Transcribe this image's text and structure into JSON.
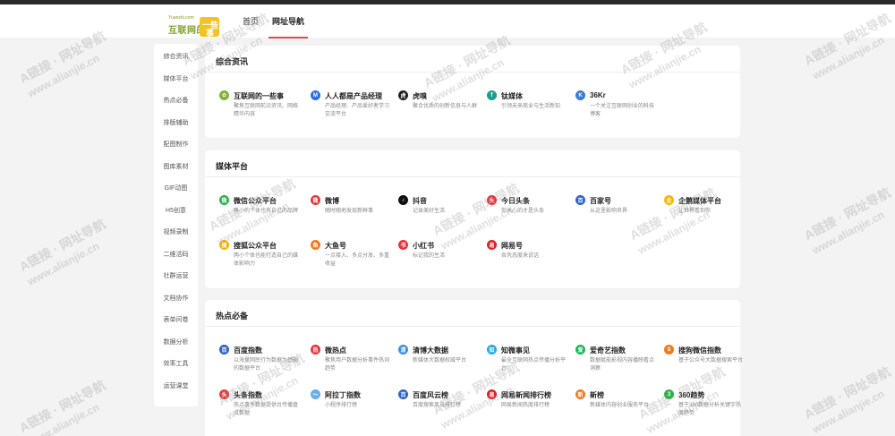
{
  "header": {
    "logo_small": "Yuanshi.com",
    "logo_main": "互联网的",
    "logo_badge_1": "一些",
    "logo_badge_2": "事",
    "nav": [
      {
        "label": "首页"
      },
      {
        "label": "网址导航"
      }
    ]
  },
  "sidebar": {
    "items": [
      {
        "label": "综合资讯"
      },
      {
        "label": "媒体平台"
      },
      {
        "label": "热点必备"
      },
      {
        "label": "排版辅助"
      },
      {
        "label": "配图制作"
      },
      {
        "label": "图库素材"
      },
      {
        "label": "GIF动图"
      },
      {
        "label": "H5创意"
      },
      {
        "label": "视频录制"
      },
      {
        "label": "二维活码"
      },
      {
        "label": "社群运营"
      },
      {
        "label": "文档协作"
      },
      {
        "label": "表单问卷"
      },
      {
        "label": "数据分析"
      },
      {
        "label": "效率工具"
      },
      {
        "label": "运营课堂"
      }
    ]
  },
  "sections": [
    {
      "title": "综合资讯",
      "sites": [
        {
          "name": "互联网的一些事",
          "desc": "聚焦互联网前沿资讯、网络精华内容",
          "icon": "leaf-icon",
          "color": "#86b234",
          "glyph": "✿"
        },
        {
          "name": "人人都是产品经理",
          "desc": "产品经理、产品爱好者学习交流平台",
          "icon": "m-logo-icon",
          "color": "#2d6fe0",
          "glyph": "M"
        },
        {
          "name": "虎嗅",
          "desc": "聚合优质的创新信息与人群",
          "icon": "huxiu-icon",
          "color": "#1f1f1f",
          "glyph": "虎"
        },
        {
          "name": "钛媒体",
          "desc": "引领未来商业与生活新知",
          "icon": "tmt-icon",
          "color": "#19a08a",
          "glyph": "T"
        },
        {
          "name": "36Kr",
          "desc": "一个关注互联网创业的科技博客",
          "icon": "36kr-icon",
          "color": "#3a7bd5",
          "glyph": "K"
        }
      ]
    },
    {
      "title": "媒体平台",
      "sites": [
        {
          "name": "微信公众平台",
          "desc": "再小的个体也有自己的品牌",
          "icon": "wechat-icon",
          "color": "#2ab246",
          "glyph": "微"
        },
        {
          "name": "微博",
          "desc": "随时随地发现新鲜事",
          "icon": "weibo-icon",
          "color": "#e2393b",
          "glyph": "微"
        },
        {
          "name": "抖音",
          "desc": "记录美好生活",
          "icon": "douyin-icon",
          "color": "#111111",
          "glyph": "♪"
        },
        {
          "name": "今日头条",
          "desc": "你关心的才是头条",
          "icon": "toutiao-icon",
          "color": "#e8363b",
          "glyph": "头"
        },
        {
          "name": "百家号",
          "desc": "从这里影响世界",
          "icon": "baijiahao-icon",
          "color": "#2e62c8",
          "glyph": "百"
        },
        {
          "name": "企鹅媒体平台",
          "desc": "让世界看到你",
          "icon": "penguin-icon",
          "color": "#f5b800",
          "glyph": "企"
        },
        {
          "name": "搜狐公众平台",
          "desc": "两小个体也能打造自己的媒体影响力",
          "icon": "sohu-icon",
          "color": "#f3b300",
          "glyph": "搜"
        },
        {
          "name": "大鱼号",
          "desc": "一点接入、多点分发、多重收益",
          "icon": "dayu-icon",
          "color": "#f07a1c",
          "glyph": "鱼"
        },
        {
          "name": "小红书",
          "desc": "标记我的生活",
          "icon": "xiaohongshu-icon",
          "color": "#e8323c",
          "glyph": "书"
        },
        {
          "name": "网易号",
          "desc": "各凭态度来说话",
          "icon": "netease-icon",
          "color": "#d8242a",
          "glyph": "易"
        }
      ]
    },
    {
      "title": "热点必备",
      "sites": [
        {
          "name": "百度指数",
          "desc": "以海量网民行为数据为基础的数据平台",
          "icon": "baidu-index-icon",
          "color": "#2e62c8",
          "glyph": "百"
        },
        {
          "name": "微热点",
          "desc": "聚焦用户数据分析事件热词趋势",
          "icon": "weiredian-icon",
          "color": "#e8323c",
          "glyph": "热"
        },
        {
          "name": "清博大数据",
          "desc": "新媒体大数据权威平台",
          "icon": "qingbo-icon",
          "color": "#3a8ee6",
          "glyph": "清"
        },
        {
          "name": "知微事见",
          "desc": "最全互联网热点传播分析平台",
          "icon": "zhiwei-icon",
          "color": "#2aa9e0",
          "glyph": "知"
        },
        {
          "name": "爱奇艺指数",
          "desc": "数据赋能影视内容播映看点洞察",
          "icon": "iqiyi-icon",
          "color": "#19b955",
          "glyph": "爱"
        },
        {
          "name": "搜狗微信指数",
          "desc": "基于公众号大数据搜索平台",
          "icon": "sogou-icon",
          "color": "#f07a1c",
          "glyph": "S"
        },
        {
          "name": "头条指数",
          "desc": "热点事件数据提供台传播盘点数据",
          "icon": "toutiao-index-icon",
          "color": "#e8363b",
          "glyph": "头"
        },
        {
          "name": "阿拉丁指数",
          "desc": "小程序排行榜",
          "icon": "aladdin-icon",
          "color": "#6aaee8",
          "glyph": "～"
        },
        {
          "name": "百度风云榜",
          "desc": "百度搜索风云排行榜",
          "icon": "baidu-top-icon",
          "color": "#2e62c8",
          "glyph": "百"
        },
        {
          "name": "网易新闻排行榜",
          "desc": "网易新闻热度排行榜",
          "icon": "netease-news-icon",
          "color": "#d8242a",
          "glyph": "易"
        },
        {
          "name": "新榜",
          "desc": "新媒体内容创业服务平台",
          "icon": "xinbang-icon",
          "color": "#f07a1c",
          "glyph": "新"
        },
        {
          "name": "360趋势",
          "desc": "基于360数据分析关键字热度趋势",
          "icon": "360-icon",
          "color": "#33b24a",
          "glyph": "3"
        }
      ]
    }
  ],
  "watermark": {
    "line1": "A链接 · 网址导航",
    "line2": "www.alianjie.cn"
  }
}
